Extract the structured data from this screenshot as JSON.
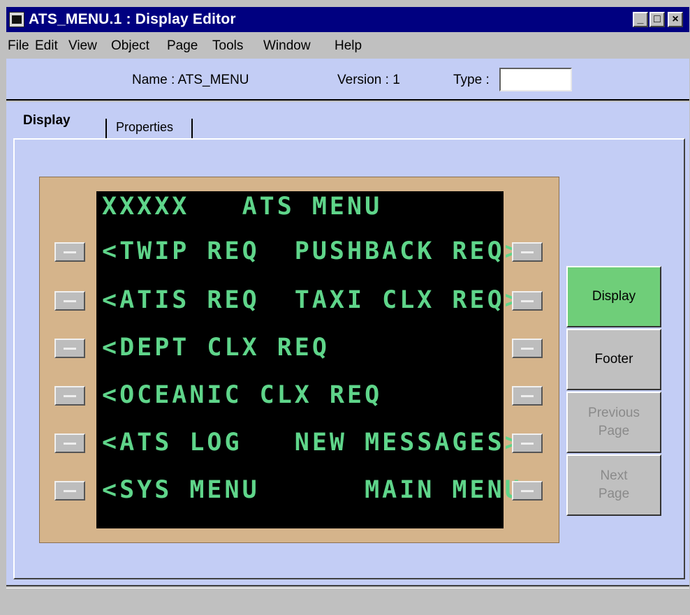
{
  "window": {
    "title": "ATS_MENU.1 : Display Editor",
    "controls": [
      "_",
      "□",
      "×"
    ]
  },
  "menu": [
    "File",
    "Edit",
    "View",
    "Object",
    "Page",
    "Tools",
    "Window",
    "Help"
  ],
  "info": {
    "name_label": "Name : ATS_MENU",
    "version_label": "Version : 1",
    "type_label": "Type :",
    "type_value": ""
  },
  "tabs": {
    "display": "Display",
    "properties": "Properties"
  },
  "cdu": {
    "lines": [
      "XXXXX   ATS MENU",
      "<TWIP REQ  PUSHBACK REQ>",
      "<ATIS REQ  TAXI CLX REQ>",
      "<DEPT CLX REQ",
      "<OCEANIC CLX REQ",
      "<ATS LOG   NEW MESSAGES>",
      "<SYS MENU      MAIN MENU>"
    ],
    "text_color": "#5fd58a"
  },
  "side_buttons": [
    {
      "label": "Display",
      "state": "active"
    },
    {
      "label": "Footer",
      "state": "enabled"
    },
    {
      "label": "Previous\nPage",
      "state": "disabled"
    },
    {
      "label": "Next\nPage",
      "state": "disabled"
    }
  ],
  "colors": {
    "title_bar": "#000080",
    "accent_active": "#6fce79",
    "panel_bg": "#c3cdf5",
    "bezel": "#d5b48b"
  }
}
